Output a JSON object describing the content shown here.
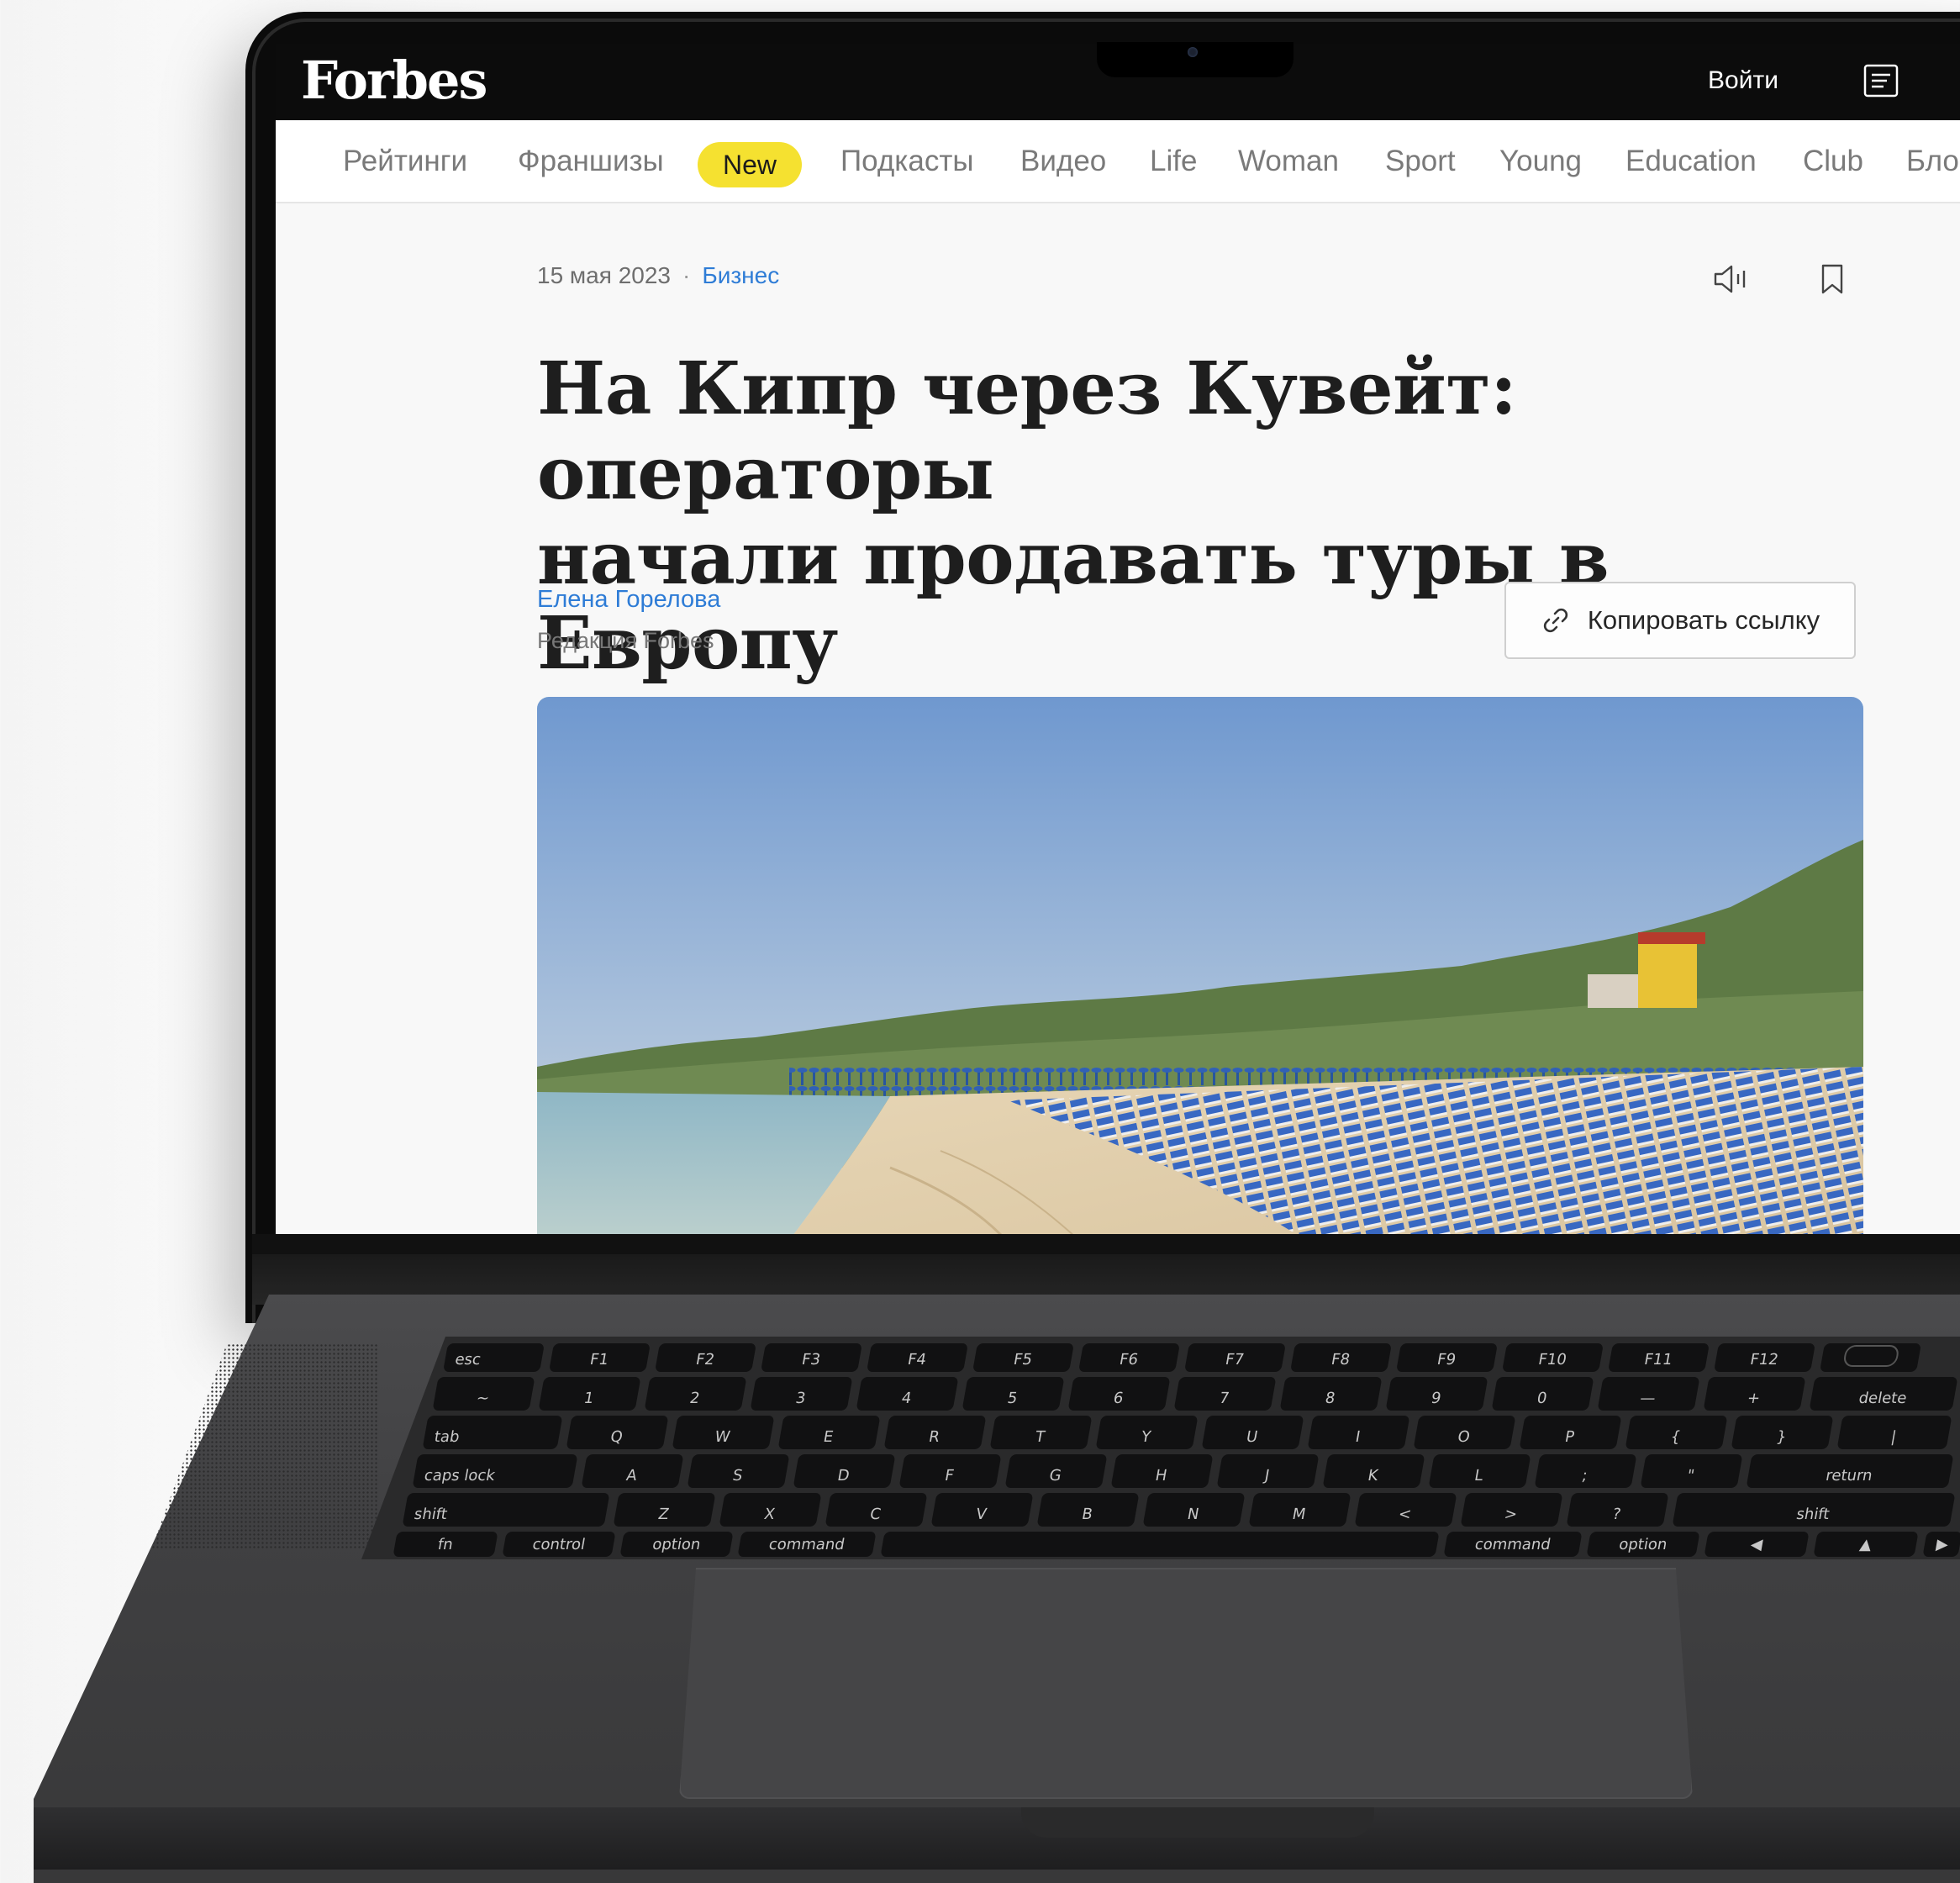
{
  "brand": {
    "logo": "Forbes"
  },
  "header": {
    "login_label": "Войти",
    "menu_icon": "menu-icon"
  },
  "nav": {
    "items": [
      "Рейтинги",
      "Франшизы",
      "New",
      "Подкасты",
      "Видео",
      "Life",
      "Woman",
      "Sport",
      "Young",
      "Education",
      "Club",
      "Бло"
    ],
    "highlight_color": "#f5e130"
  },
  "article": {
    "date": "15 мая 2023",
    "separator": "·",
    "category": "Бизнес",
    "title_line1": "На Кипр через Кувейт: операторы",
    "title_line2": "начали продавать туры в Европу",
    "author": "Елена Горелова",
    "author_role": "Редакция Forbes",
    "copy_link_label": "Копировать ссылку",
    "image_alt": "Beach with blue sun loungers",
    "accent_color": "#2e7cd6"
  },
  "keyboard": {
    "fn_row": [
      "esc",
      "F1",
      "F2",
      "F3",
      "F4",
      "F5",
      "F6",
      "F7",
      "F8",
      "F9",
      "F10",
      "F11",
      "F12"
    ],
    "num_row": [
      "~",
      "1",
      "2",
      "3",
      "4",
      "5",
      "6",
      "7",
      "8",
      "9",
      "0",
      "—",
      "+",
      "delete"
    ],
    "row_q": [
      "tab",
      "Q",
      "W",
      "E",
      "R",
      "T",
      "Y",
      "U",
      "I",
      "O",
      "P",
      "{",
      "}",
      "|"
    ],
    "row_a": [
      "caps lock",
      "A",
      "S",
      "D",
      "F",
      "G",
      "H",
      "J",
      "K",
      "L",
      ";",
      "\"",
      "return"
    ],
    "row_z": [
      "shift",
      "Z",
      "X",
      "C",
      "V",
      "B",
      "N",
      "M",
      "<",
      ">",
      "?",
      "shift"
    ],
    "row_bottom": [
      "fn",
      "control",
      "option",
      "command",
      "",
      "command",
      "option",
      "◀",
      "▲",
      "▶"
    ]
  }
}
